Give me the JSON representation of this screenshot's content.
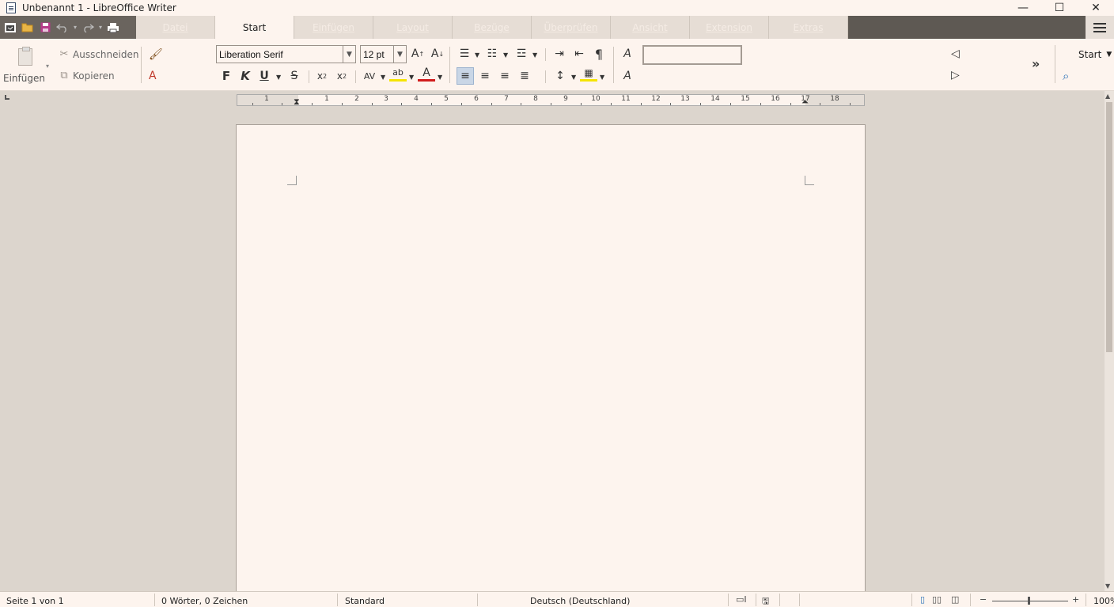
{
  "window": {
    "title": "Unbenannt 1 - LibreOffice Writer",
    "controls": {
      "minimize": "—",
      "maximize": "☐",
      "close": "✕"
    }
  },
  "quick_toolbar": {
    "icons": [
      "start-center-icon",
      "open-icon",
      "save-icon",
      "undo-icon",
      "redo-icon",
      "print-icon"
    ]
  },
  "tabs": [
    {
      "label": "Datei",
      "active": false
    },
    {
      "label": "Start",
      "active": true
    },
    {
      "label": "Einfügen",
      "active": false
    },
    {
      "label": "Layout",
      "active": false
    },
    {
      "label": "Bezüge",
      "active": false
    },
    {
      "label": "Überprüfen",
      "active": false
    },
    {
      "label": "Ansicht",
      "active": false
    },
    {
      "label": "Extension",
      "active": false
    },
    {
      "label": "Extras",
      "active": false
    }
  ],
  "ribbon": {
    "paste_label": "Einfügen",
    "cut_label": "Ausschneiden",
    "copy_label": "Kopieren",
    "font_name": "Liberation Serif",
    "font_size": "12 pt",
    "bold": "F",
    "italic": "K",
    "underline": "U",
    "strike": "S",
    "style_value": "",
    "mode_label": "Start"
  },
  "ruler": {
    "numbers": [
      "1",
      "1",
      "2",
      "3",
      "4",
      "5",
      "6",
      "7",
      "8",
      "9",
      "10",
      "11",
      "12",
      "13",
      "14",
      "15",
      "16",
      "17",
      "18"
    ]
  },
  "status": {
    "page": "Seite 1 von 1",
    "words": "0 Wörter, 0 Zeichen",
    "style": "Standard",
    "language": "Deutsch (Deutschland)",
    "zoom": "100%"
  },
  "colors": {
    "accent_tab_bg": "#fdf4ee",
    "tab_bar_bg": "#5e5953",
    "highlight": "#f5e400",
    "font_color": "#d11c1c"
  }
}
